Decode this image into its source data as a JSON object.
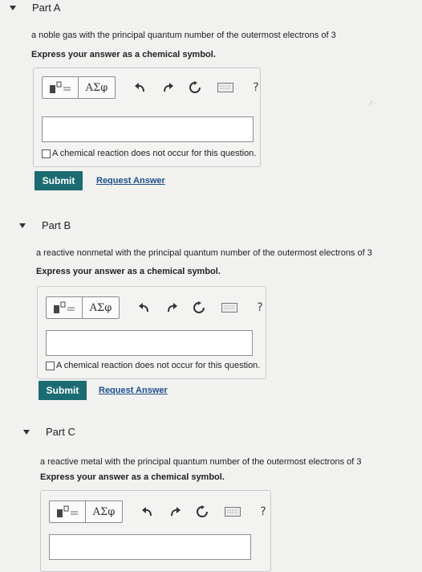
{
  "colors": {
    "background": "#f1f1f0",
    "submit_bg": "#1b6b72",
    "link": "#1d4f8a"
  },
  "toolbar": {
    "template_icon": "fraction-template-icon",
    "greek_label": "ΑΣφ",
    "undo_icon": "undo-icon",
    "redo_icon": "redo-icon",
    "reset_icon": "reset-icon",
    "keyboard_icon": "keyboard-icon",
    "help_label": "?"
  },
  "parts": [
    {
      "title": "Part A",
      "question": "a noble gas with the principal quantum number of the outermost electrons of 3",
      "instruction": "Express your answer as a chemical symbol.",
      "input_value": "",
      "no_reaction_label": "A chemical reaction does not occur for this question.",
      "submit_label": "Submit",
      "request_label": "Request Answer"
    },
    {
      "title": "Part B",
      "question": "a reactive nonmetal with the principal quantum number of the outermost electrons of 3",
      "instruction": "Express your answer as a chemical symbol.",
      "input_value": "",
      "no_reaction_label": "A chemical reaction does not occur for this question.",
      "submit_label": "Submit",
      "request_label": "Request Answer"
    },
    {
      "title": "Part C",
      "question": "a reactive metal with the principal quantum number of the outermost electrons of 3",
      "instruction": "Express your answer as a chemical symbol.",
      "input_value": ""
    }
  ]
}
